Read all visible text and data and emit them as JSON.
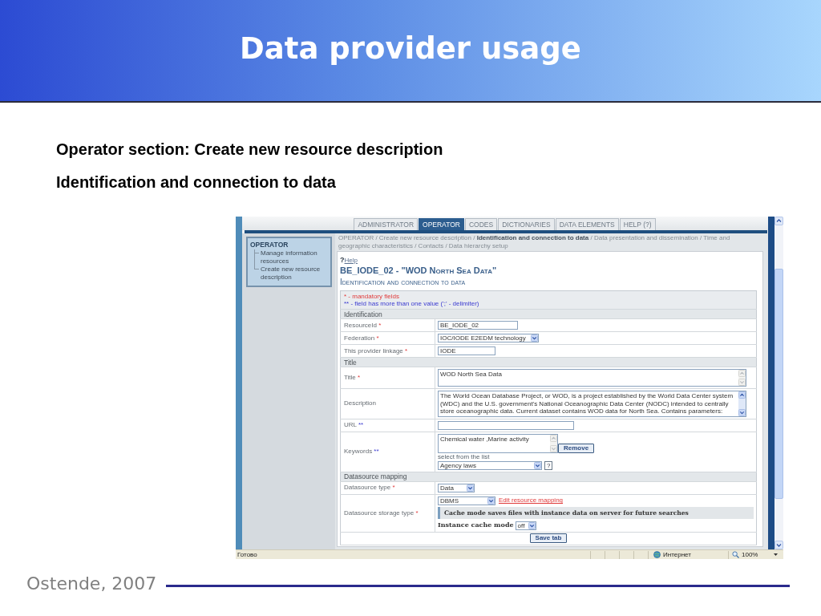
{
  "slide": {
    "title": "Data provider usage",
    "lines": [
      "Operator section: Create new resource description",
      "Identification and connection to data"
    ],
    "footer": "Ostende, 2007"
  },
  "app_screenshot": {
    "tabs": [
      {
        "label": "ADMINISTRATOR",
        "selected": false
      },
      {
        "label": "OPERATOR",
        "selected": true
      },
      {
        "label": "CODES",
        "selected": false
      },
      {
        "label": "DICTIONARIES",
        "selected": false
      },
      {
        "label": "DATA ELEMENTS",
        "selected": false
      },
      {
        "label": "HELP (?)",
        "selected": false
      }
    ],
    "sidebar": {
      "heading": "OPERATOR",
      "items": [
        {
          "label": "Manage information resources"
        },
        {
          "label": "Create new resource description"
        }
      ]
    },
    "breadcrumb": "OPERATOR / Create new resource description / **Identification and connection to data** / Data presentation and dissemination / Time and geographic characteristics / Contacts / Data hierarchy setup",
    "help": {
      "mark": "?",
      "link": "Help"
    },
    "record_title": "BE_IODE_02 - \"WOD North Sea Data\"",
    "page_heading": "Identification and connection to data",
    "notes": [
      {
        "kind": "mandatory",
        "text": "* - mandatory fields"
      },
      {
        "kind": "multi",
        "text": "** - field has more than one value (';' - delimiter)"
      }
    ],
    "sections": [
      {
        "title": "Identification",
        "rows": [
          {
            "label": "ResourceId",
            "marker": {
              "kind": "mandatory",
              "text": "*"
            },
            "control": {
              "kind": "input",
              "value": "BE_IODE_02"
            }
          },
          {
            "label": "Federation",
            "marker": {
              "kind": "mandatory",
              "text": "*"
            },
            "control": {
              "kind": "select",
              "value": "IOC/IODE E2EDM technology"
            }
          },
          {
            "label": "This provider linkage",
            "marker": {
              "kind": "mandatory",
              "text": "*"
            },
            "control": {
              "kind": "input",
              "value": "IODE"
            }
          }
        ]
      },
      {
        "title": "Title",
        "rows": [
          {
            "label": "Title",
            "marker": {
              "kind": "mandatory",
              "text": "*"
            },
            "control": {
              "kind": "textarea",
              "value": "WOD North Sea Data",
              "scrollable": false
            }
          },
          {
            "label": "Description",
            "control": {
              "kind": "textarea",
              "value": "The World Ocean Database Project, or WOD, is a project established by the World Data Center system (WDC) and the U.S. government's National Oceanographic Data Center (NODC) intended to centrally store oceanographic data. Current dataset contains WOD data for North Sea. Contains parameters:",
              "scrollable": true
            }
          },
          {
            "label": "URL",
            "marker": {
              "kind": "multi",
              "text": "**"
            },
            "control": {
              "kind": "input"
            }
          },
          {
            "label": "Keywords",
            "marker": {
              "kind": "multi",
              "text": "**"
            },
            "control": {
              "kind": "keywords",
              "value": "Chemical water ,Marine activity",
              "scrollable": false,
              "button": "Remove",
              "hint": "select from the list",
              "choice": "Agency laws",
              "help": "?"
            }
          }
        ]
      },
      {
        "title": "Datasource mapping",
        "rows": [
          {
            "label": "Datasource type",
            "marker": {
              "kind": "mandatory",
              "text": "*"
            },
            "control": {
              "kind": "select",
              "value": "Data"
            }
          },
          {
            "label": "Datasource storage type",
            "marker": {
              "kind": "mandatory",
              "text": "*"
            },
            "control": {
              "kind": "storage",
              "value": "DBMS",
              "link": "Edit resource mapping",
              "info": "Cache mode saves files with instance data on server for future searches",
              "cache_label": "Instance cache mode",
              "cache_value": "off"
            }
          }
        ]
      }
    ],
    "save_button": "Save tab",
    "status_bar": {
      "status": "Готово",
      "zone": "Интернет",
      "zoom": "100%"
    }
  }
}
